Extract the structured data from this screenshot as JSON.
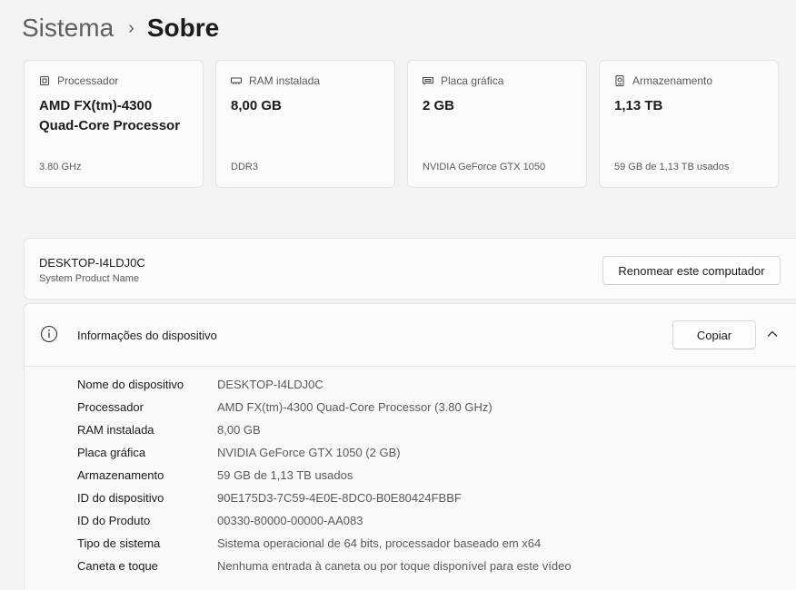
{
  "breadcrumb": {
    "parent": "Sistema",
    "separator": "›",
    "current": "Sobre"
  },
  "cards": [
    {
      "icon": "processor-icon",
      "label": "Processador",
      "value": "AMD FX(tm)-4300 Quad-Core Processor",
      "sub": "3.80 GHz"
    },
    {
      "icon": "ram-icon",
      "label": "RAM instalada",
      "value": "8,00 GB",
      "sub": "DDR3"
    },
    {
      "icon": "graphics-card-icon",
      "label": "Placa gráfica",
      "value": "2 GB",
      "sub": "NVIDIA GeForce GTX 1050"
    },
    {
      "icon": "storage-icon",
      "label": "Armazenamento",
      "value": "1,13 TB",
      "sub": "59 GB de 1,13 TB usados"
    }
  ],
  "computer": {
    "name": "DESKTOP-I4LDJ0C",
    "product": "System Product Name",
    "rename_label": "Renomear este computador"
  },
  "device_info": {
    "title": "Informações do dispositivo",
    "copy_label": "Copiar",
    "rows": [
      {
        "label": "Nome do dispositivo",
        "value": "DESKTOP-I4LDJ0C"
      },
      {
        "label": "Processador",
        "value": "AMD FX(tm)-4300 Quad-Core Processor (3.80 GHz)"
      },
      {
        "label": "RAM instalada",
        "value": "8,00 GB"
      },
      {
        "label": "Placa gráfica",
        "value": "NVIDIA GeForce GTX 1050 (2 GB)"
      },
      {
        "label": "Armazenamento",
        "value": "59 GB de 1,13 TB usados"
      },
      {
        "label": "ID do dispositivo",
        "value": "90E175D3-7C59-4E0E-8DC0-B0E80424FBBF"
      },
      {
        "label": "ID do Produto",
        "value": "00330-80000-00000-AA083"
      },
      {
        "label": "Tipo de sistema",
        "value": "Sistema operacional de 64 bits, processador baseado em x64"
      },
      {
        "label": "Caneta e toque",
        "value": "Nenhuma entrada à caneta ou por toque disponível para este vídeo"
      }
    ]
  }
}
